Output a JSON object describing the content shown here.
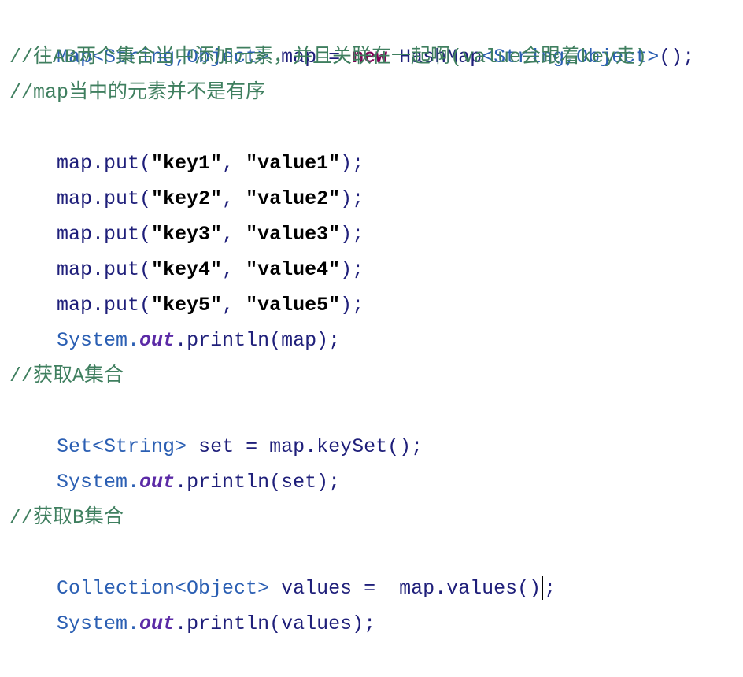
{
  "editor": {
    "lines": [
      {
        "type": "map-decl",
        "tokens": [
          "Map",
          "<String,Object>",
          " map = ",
          "new",
          " HashMap",
          "<String,Object>",
          "();"
        ]
      },
      {
        "type": "comment",
        "text": "//往AB两个集合当中添加元素，并且关联在一起啊(value会跟着key走)"
      },
      {
        "type": "comment",
        "text": "//map当中的元素并不是有序"
      },
      {
        "type": "put",
        "prefix": "map.put(",
        "key": "\"key1\"",
        "sep": ", ",
        "value": "\"value1\"",
        "suffix": ");"
      },
      {
        "type": "put",
        "prefix": "map.put(",
        "key": "\"key2\"",
        "sep": ", ",
        "value": "\"value2\"",
        "suffix": ");"
      },
      {
        "type": "put",
        "prefix": "map.put(",
        "key": "\"key3\"",
        "sep": ", ",
        "value": "\"value3\"",
        "suffix": ");"
      },
      {
        "type": "put",
        "prefix": "map.put(",
        "key": "\"key4\"",
        "sep": ", ",
        "value": "\"value4\"",
        "suffix": ");"
      },
      {
        "type": "put",
        "prefix": "map.put(",
        "key": "\"key5\"",
        "sep": ", ",
        "value": "\"value5\"",
        "suffix": ");"
      },
      {
        "type": "println",
        "system": "System.",
        "out": "out",
        "rest": ".println(map);"
      },
      {
        "type": "blank"
      },
      {
        "type": "comment",
        "text": "//获取A集合"
      },
      {
        "type": "set-decl",
        "t1": "Set",
        "t2": "<String>",
        "rest": " set = map.keySet();"
      },
      {
        "type": "println",
        "system": "System.",
        "out": "out",
        "rest": ".println(set);"
      },
      {
        "type": "blank"
      },
      {
        "type": "comment",
        "text": "//获取B集合"
      },
      {
        "type": "coll-decl",
        "t1": "Collection",
        "t2": "<Object>",
        "rest": " values =  map.values()",
        "end": ";"
      },
      {
        "type": "println",
        "system": "System.",
        "out": "out",
        "rest": ".println(values);"
      }
    ]
  }
}
